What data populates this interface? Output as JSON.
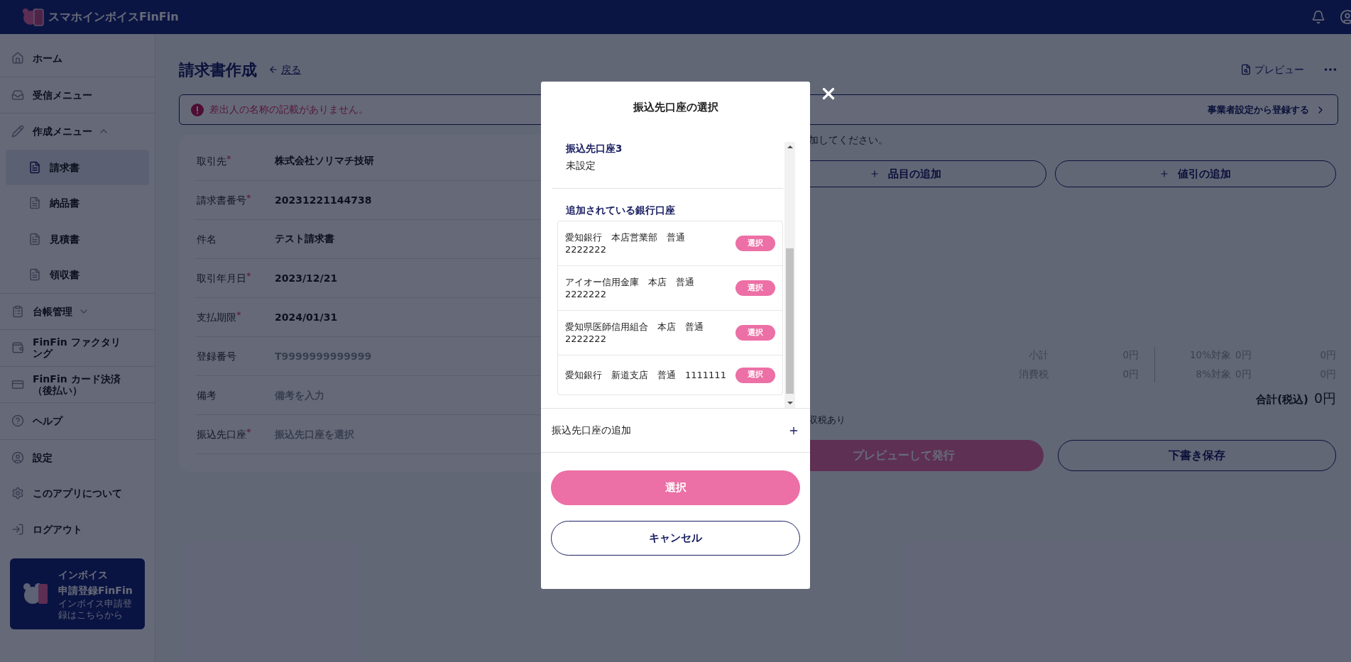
{
  "header": {
    "logo_text": "スマホインボイスFinFin"
  },
  "sidebar": {
    "sections": [
      [
        {
          "label": "ホーム",
          "selected": false
        }
      ],
      [
        {
          "label": "受信メニュー",
          "selected": false
        }
      ],
      [
        {
          "label": "作成メニュー",
          "selected": false,
          "expanded": true,
          "children": [
            {
              "label": "請求書",
              "selected": true
            },
            {
              "label": "納品書",
              "selected": false
            },
            {
              "label": "見積書",
              "selected": false
            },
            {
              "label": "領収書",
              "selected": false
            }
          ]
        }
      ],
      [
        {
          "label": "台帳管理",
          "selected": false,
          "expanded": false
        }
      ],
      [
        {
          "label": "FinFin ファクタリング",
          "selected": false
        }
      ],
      [
        {
          "label": "FinFin カード決済（後払い）",
          "selected": false
        }
      ],
      [
        {
          "label": "ヘルプ",
          "selected": false
        }
      ],
      [
        {
          "label": "設定",
          "selected": false
        },
        {
          "label": "このアプリについて",
          "selected": false
        },
        {
          "label": "ログアウト",
          "selected": false
        }
      ]
    ],
    "promo": {
      "title": "インボイス",
      "subtitle": "申請登録FinFin",
      "text": "インボイス申請登録はこちらから"
    }
  },
  "page": {
    "title": "請求書作成",
    "back": "戻る",
    "preview": "プレビュー"
  },
  "warning": {
    "message": "差出人の名称の記載がありません。",
    "link": "事業者設定から登録する"
  },
  "form": {
    "required_mark": "*",
    "rows": [
      {
        "label": "取引先",
        "required": true,
        "value": "株式会社ソリマチ技研"
      },
      {
        "label": "請求書番号",
        "required": true,
        "value": "20231221144738"
      },
      {
        "label": "件名",
        "required": false,
        "value": "テスト請求書"
      },
      {
        "label": "取引年月日",
        "required": true,
        "value": "2023/12/21"
      },
      {
        "label": "支払期限",
        "required": true,
        "value": "2024/01/31"
      },
      {
        "label": "登録番号",
        "required": false,
        "placeholder": "T9999999999999"
      },
      {
        "label": "備考",
        "required": false,
        "placeholder": "備考を入力"
      },
      {
        "label": "振込先口座",
        "required": true,
        "placeholder": "振込先口座を選択"
      }
    ]
  },
  "items": {
    "hint": "加してください。",
    "add_buttons": [
      "品目の追加",
      "値引の追加"
    ]
  },
  "totals": {
    "left": [
      {
        "label": "小計",
        "value": "0円"
      },
      {
        "label": "消費税",
        "value": "0円"
      }
    ],
    "right": [
      {
        "label": "10%対象",
        "amount": "0円",
        "value": "0円"
      },
      {
        "label": "8%対象",
        "amount": "0円",
        "value": "0円"
      }
    ],
    "total_label": "合計(税込)",
    "total_value": "0円",
    "note": "収税あり"
  },
  "actions": {
    "issue": "プレビューして発行",
    "draft": "下書き保存"
  },
  "modal": {
    "title": "振込先口座の選択",
    "current": {
      "title": "振込先口座3",
      "value": "未設定"
    },
    "list_title": "追加されている銀行口座",
    "accounts": [
      {
        "text": "愛知銀行　本店営業部　普通\n2222222",
        "button": "選択"
      },
      {
        "text": "アイオー信用金庫　本店　普通\n2222222",
        "button": "選択"
      },
      {
        "text": "愛知県医師信用組合　本店　普通\n2222222",
        "button": "選択"
      },
      {
        "text": "愛知銀行　新道支店　普通　1111111",
        "button": "選択"
      }
    ],
    "add_label": "振込先口座の追加",
    "select": "選択",
    "cancel": "キャンセル"
  }
}
